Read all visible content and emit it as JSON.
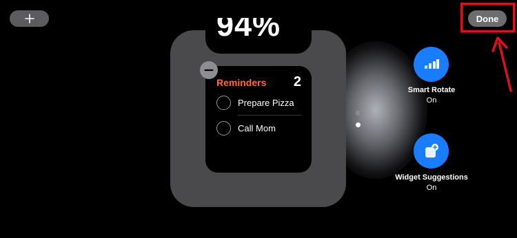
{
  "toolbar": {
    "add_icon": "plus-icon",
    "done_label": "Done"
  },
  "battery_widget": {
    "percent_text": "94%"
  },
  "reminders_widget": {
    "title": "Reminders",
    "count": "2",
    "items": [
      {
        "label": "Prepare Pizza"
      },
      {
        "label": "Call Mom"
      }
    ],
    "title_color": "#ff6a3c",
    "remove_icon": "minus-icon"
  },
  "page_indicator": {
    "pages": 2,
    "active_page": 2
  },
  "options": [
    {
      "label": "Smart Rotate",
      "state": "On",
      "icon": "smart-rotate-icon"
    },
    {
      "label": "Widget Suggestions",
      "state": "On",
      "icon": "widget-suggestions-icon"
    }
  ],
  "colors": {
    "accent_blue": "#1a7cff",
    "annotation_red": "#e0101a",
    "stack_gray": "#4a4a4c"
  }
}
